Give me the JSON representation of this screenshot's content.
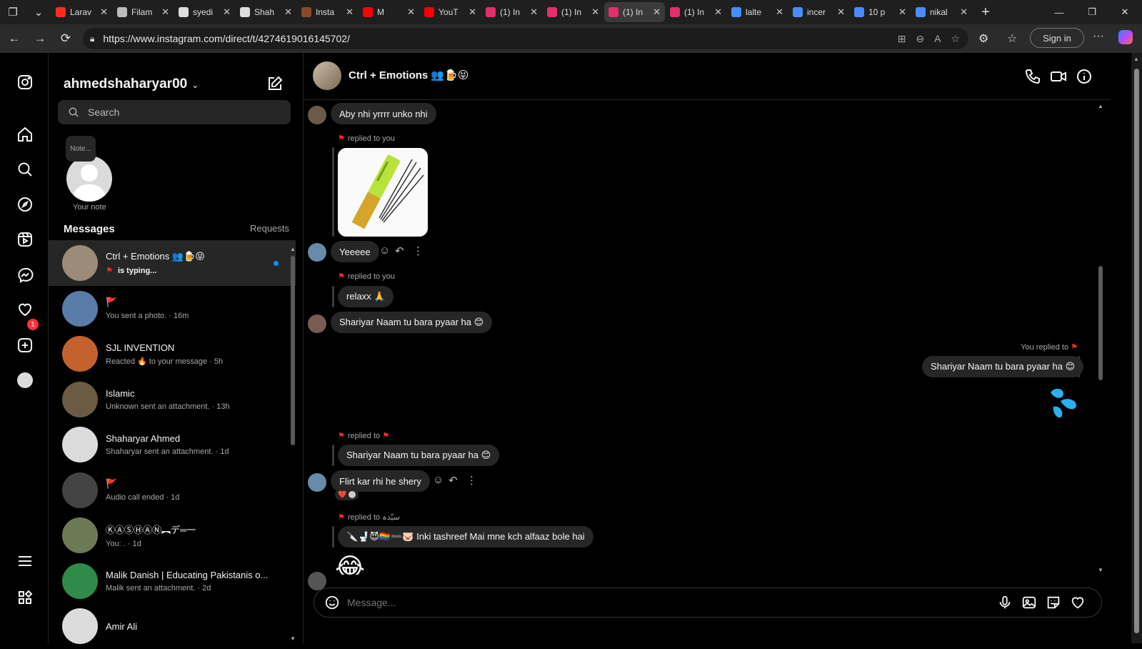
{
  "browser": {
    "tabs": [
      {
        "label": "Larav",
        "color": "#ff2d20"
      },
      {
        "label": "Filam",
        "color": "#bbbbbb"
      },
      {
        "label": "syedi",
        "color": "#dddddd"
      },
      {
        "label": "Shah",
        "color": "#dddddd"
      },
      {
        "label": "Insta",
        "color": "#8a4a2a"
      },
      {
        "label": "M",
        "color": "#ff0000"
      },
      {
        "label": "YouT",
        "color": "#ff0000"
      },
      {
        "label": "(1) In",
        "color": "#e1306c"
      },
      {
        "label": "(1) In",
        "color": "#e1306c"
      },
      {
        "label": "(1) In",
        "color": "#e1306c"
      },
      {
        "label": "(1) In",
        "color": "#e1306c"
      },
      {
        "label": "lalte",
        "color": "#4a8cff"
      },
      {
        "label": "incer",
        "color": "#4a8cff"
      },
      {
        "label": "10 p",
        "color": "#4a8cff"
      },
      {
        "label": "nikal",
        "color": "#4a8cff"
      }
    ],
    "url": "https://www.instagram.com/direct/t/4274619016145702/",
    "sign_in": "Sign in"
  },
  "inbox": {
    "username": "ahmedshaharyar00",
    "search_placeholder": "Search",
    "note_bubble": "Note...",
    "note_label": "Your note",
    "messages_header": "Messages",
    "requests": "Requests",
    "badge_count": "1",
    "conversations": [
      {
        "name": "Ctrl + Emotions 👥🍺😝",
        "preview": "is typing...",
        "color": "#9c8b78"
      },
      {
        "name": "🚩",
        "preview": "You sent a photo. · 16m",
        "color": "#5a7ca8"
      },
      {
        "name": "SJL INVENTION",
        "preview": "Reacted 🔥 to your message · 5h",
        "color": "#c4622d"
      },
      {
        "name": "Islamic",
        "preview": "Unknown sent an attachment. · 13h",
        "color": "#6b5a44"
      },
      {
        "name": "Shaharyar Ahmed",
        "preview": "Shaharyar sent an attachment. · 1d",
        "color": "#dbdbdb"
      },
      {
        "name": "🚩",
        "preview": "Audio call ended · 1d",
        "color": "#444444"
      },
      {
        "name": "ⓀⒶⓈⒽⒶⓃ︻デ═一",
        "preview": "You: . · 1d",
        "color": "#6b7a55"
      },
      {
        "name": "Malik Danish | Educating Pakistanis o...",
        "preview": "Malik sent an attachment. · 2d",
        "color": "#2e8b4a"
      },
      {
        "name": "Amir Ali",
        "preview": "",
        "color": "#dbdbdb"
      }
    ]
  },
  "chat": {
    "title": "Ctrl + Emotions 👥🍺😝",
    "messages": {
      "m1": "Aby nhi yrrrr unko nhi",
      "r1": "replied to you",
      "m2": "Yeeeee",
      "r2": "replied to you",
      "q2": "relaxx 🙏",
      "m3": "Shariyar Naam tu bara pyaar ha 😊",
      "r_you": "You replied to",
      "m4": "Shariyar Naam tu bara pyaar ha 😊",
      "r3": "replied to",
      "q3": "Shariyar Naam tu bara pyaar ha 😊",
      "m5": "Flirt kar rhi he shery",
      "reaction": "❤️",
      "r4": "replied to سیّدہ",
      "q4": "🔪🚽😈🏳️‍🌈➖🐷 Inki tashreef Mai mne kch alfaaz bole hai",
      "big_emoji": "😂"
    },
    "composer_placeholder": "Message..."
  },
  "colors": {
    "accent": "#0095f6",
    "badge": "#ff3040",
    "flag": "#ff2b2b",
    "sticker": "#2ab0f0"
  }
}
